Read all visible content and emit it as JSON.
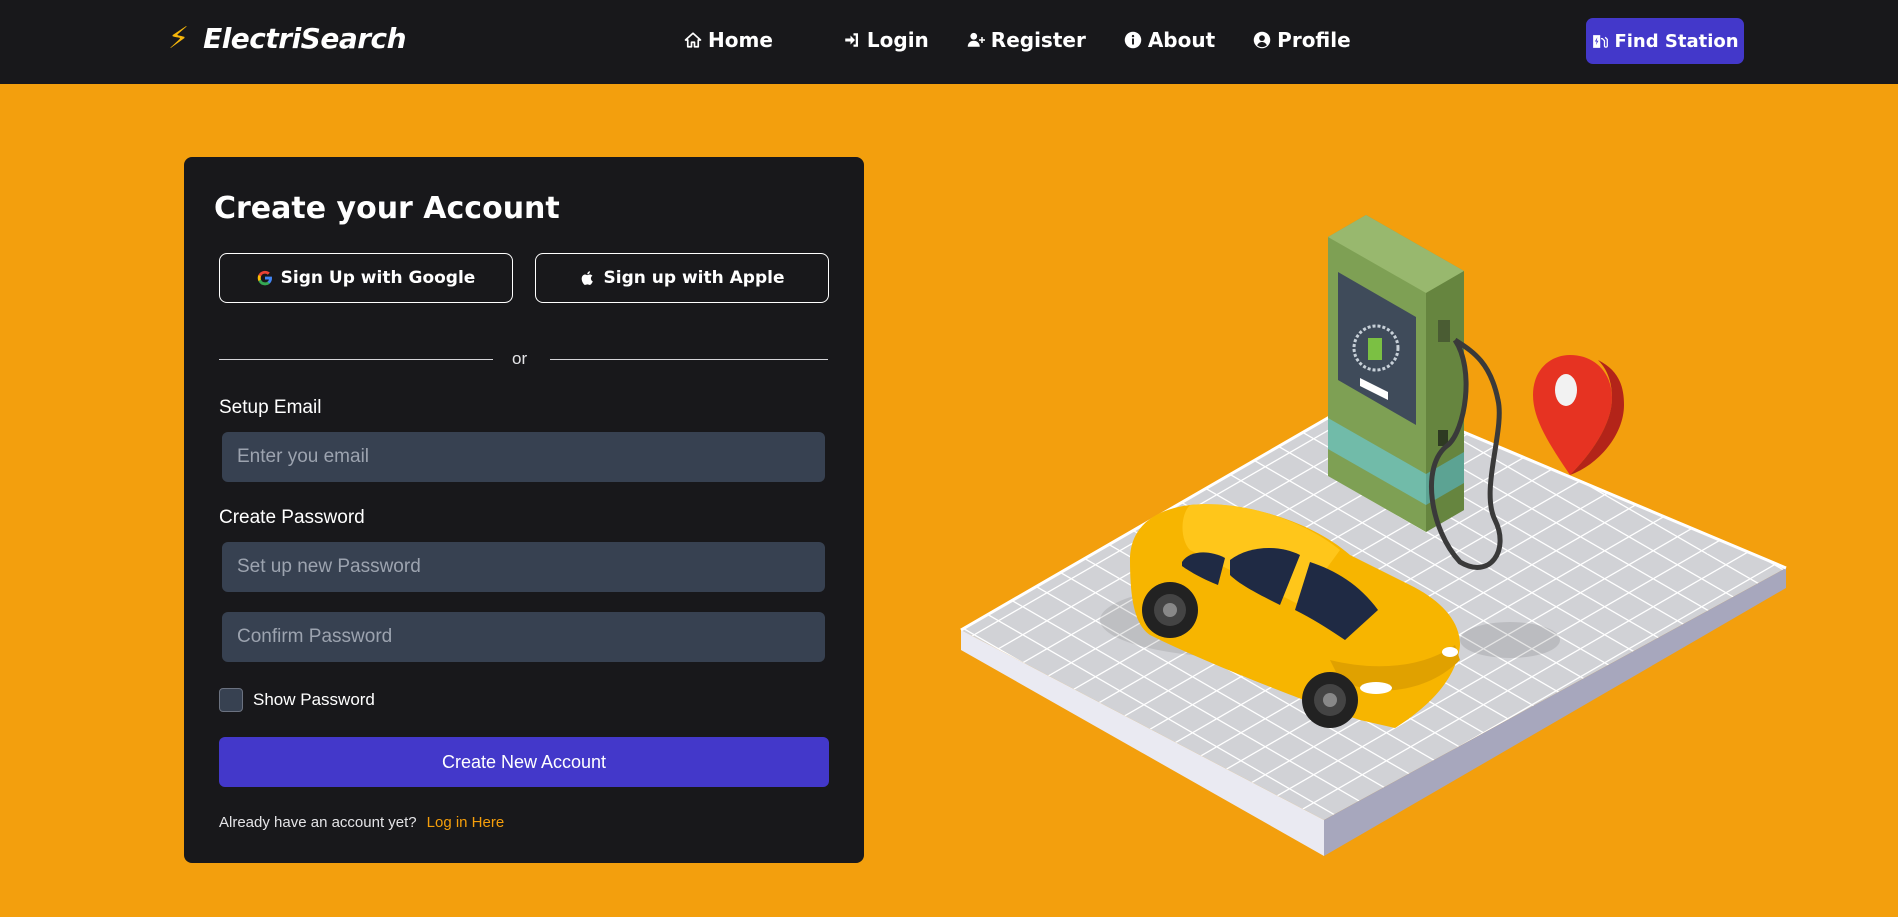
{
  "navbar": {
    "brand": "ElectriSearch",
    "brand_icon": "⚡",
    "links": [
      {
        "label": "Home",
        "icon": "home-icon"
      },
      {
        "label": "Login",
        "icon": "login-icon"
      },
      {
        "label": "Register",
        "icon": "user-plus-icon"
      },
      {
        "label": "About",
        "icon": "info-icon"
      },
      {
        "label": "Profile",
        "icon": "user-circle-icon"
      }
    ],
    "cta": {
      "label": "Find Station",
      "icon": "charging-station-icon"
    }
  },
  "form": {
    "title": "Create your Account",
    "google_label": "Sign Up with Google",
    "apple_label": "Sign up with Apple",
    "divider": "or",
    "email_label": "Setup Email",
    "email_placeholder": "Enter you email",
    "password_label": "Create Password",
    "password_placeholder": "Set up new Password",
    "confirm_placeholder": "Confirm Password",
    "show_password_label": "Show Password",
    "submit_label": "Create New Account",
    "footer_text": "Already have an account yet?",
    "footer_link": "Log in Here"
  },
  "colors": {
    "background": "#f39f0d",
    "navbar": "#18181b",
    "card": "#18181b",
    "accent": "#4338ca",
    "input": "#374151",
    "link": "#f59e0b"
  }
}
